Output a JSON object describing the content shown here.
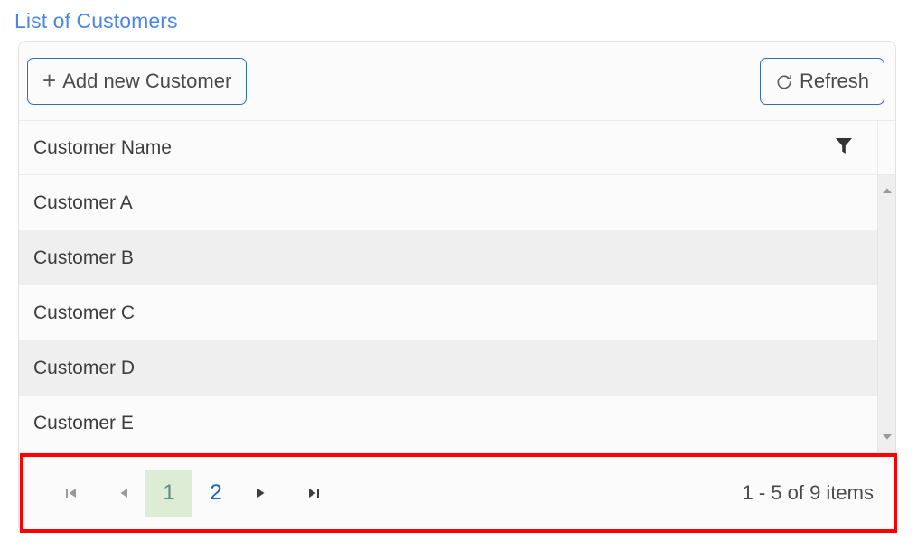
{
  "page": {
    "title": "List of Customers"
  },
  "toolbar": {
    "add_label": "Add new Customer",
    "add_icon": "plus-icon",
    "refresh_label": "Refresh",
    "refresh_icon": "refresh-icon"
  },
  "grid": {
    "columns": [
      {
        "label": "Customer Name",
        "filter_icon": "filter-icon"
      }
    ],
    "rows": [
      {
        "name": "Customer A"
      },
      {
        "name": "Customer B"
      },
      {
        "name": "Customer C"
      },
      {
        "name": "Customer D"
      },
      {
        "name": "Customer E"
      }
    ],
    "scrollbar": {
      "up_icon": "chevron-up-icon",
      "down_icon": "chevron-down-icon"
    }
  },
  "pager": {
    "first_icon": "first-page-icon",
    "prev_icon": "previous-page-icon",
    "next_icon": "next-page-icon",
    "last_icon": "last-page-icon",
    "pages": [
      {
        "label": "1",
        "selected": true
      },
      {
        "label": "2",
        "selected": false
      }
    ],
    "info": "1 - 5 of 9 items"
  },
  "colors": {
    "title_blue": "#4a86e8",
    "button_border_blue": "#3370b3",
    "link_blue": "#1266c0",
    "selected_page_bg": "#dcecd5",
    "annotation_red": "#fe0000",
    "row_alt_bg": "#efefef"
  }
}
